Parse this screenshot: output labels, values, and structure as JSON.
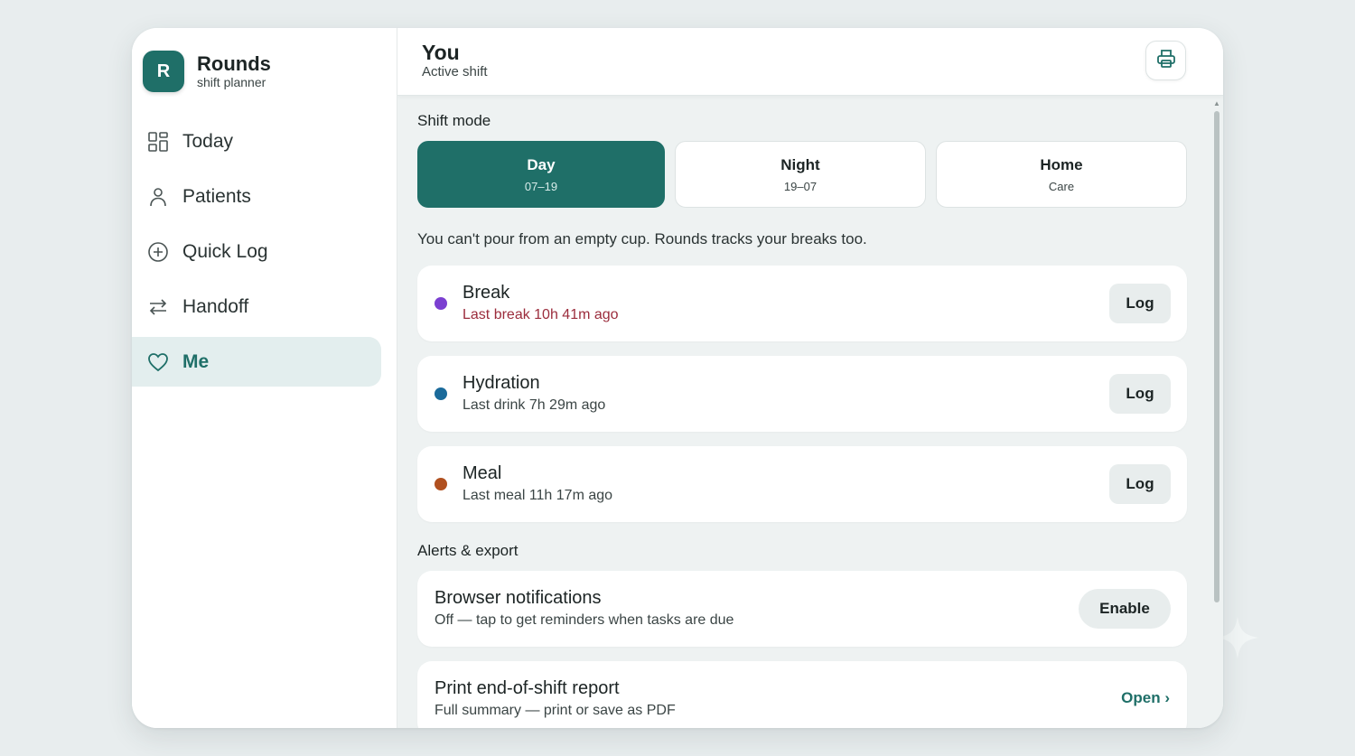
{
  "app": {
    "name": "Rounds",
    "subtitle": "shift planner",
    "logo_letter": "R"
  },
  "nav": [
    {
      "label": "Today",
      "icon": "grid-icon",
      "active": false
    },
    {
      "label": "Patients",
      "icon": "person-icon",
      "active": false
    },
    {
      "label": "Quick Log",
      "icon": "plus-circle-icon",
      "active": false
    },
    {
      "label": "Handoff",
      "icon": "swap-arrows-icon",
      "active": false
    },
    {
      "label": "Me",
      "icon": "heart-icon",
      "active": true
    }
  ],
  "header": {
    "title": "You",
    "subtitle": "Active shift",
    "print_icon": "printer-icon"
  },
  "shift_mode": {
    "label": "Shift mode",
    "options": [
      {
        "label": "Day",
        "sub": "07–19",
        "selected": true
      },
      {
        "label": "Night",
        "sub": "19–07",
        "selected": false
      },
      {
        "label": "Home",
        "sub": "Care",
        "selected": false
      }
    ]
  },
  "quote": "You can't pour from an empty cup. Rounds tracks your breaks too.",
  "self_care": [
    {
      "title": "Break",
      "status": "Last break 10h 41m ago",
      "color": "#7b3fd1",
      "warning": true,
      "button": "Log"
    },
    {
      "title": "Hydration",
      "status": "Last drink 7h 29m ago",
      "color": "#1a6a9a",
      "warning": false,
      "button": "Log"
    },
    {
      "title": "Meal",
      "status": "Last meal 11h 17m ago",
      "color": "#b0501f",
      "warning": false,
      "button": "Log"
    }
  ],
  "alerts": {
    "label": "Alerts & export",
    "notifications": {
      "title": "Browser notifications",
      "status": "Off — tap to get reminders when tasks are due",
      "button": "Enable"
    },
    "report": {
      "title": "Print end-of-shift report",
      "desc": "Full summary — print or save as PDF",
      "link": "Open ›"
    }
  },
  "colors": {
    "accent": "#1f6f68",
    "warning_text": "#9b2c3c",
    "background": "#eef2f2"
  }
}
